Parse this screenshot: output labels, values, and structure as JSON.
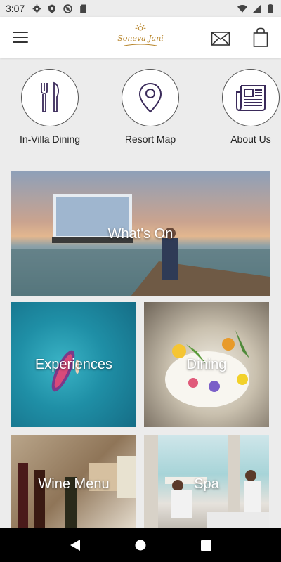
{
  "status_bar": {
    "time": "3:07",
    "left_icons": [
      "gear-icon",
      "shield-icon",
      "no-sync-icon",
      "sd-card-icon"
    ],
    "right_icons": [
      "wifi-icon",
      "signal-icon",
      "battery-icon"
    ]
  },
  "app_bar": {
    "logo_text": "Soneva Jani",
    "brand_color": "#b8862d"
  },
  "quick_links": [
    {
      "label": "In-Villa Dining",
      "icon": "fork-knife-icon"
    },
    {
      "label": "Resort Map",
      "icon": "map-pin-icon"
    },
    {
      "label": "About Us",
      "icon": "newspaper-icon"
    }
  ],
  "tiles": {
    "whats_on": "What's On",
    "experiences": "Experiences",
    "dining": "Dining",
    "wine_menu": "Wine Menu",
    "spa": "Spa"
  },
  "colors": {
    "icon_stroke": "#3a2a5a",
    "background": "#ececec"
  }
}
